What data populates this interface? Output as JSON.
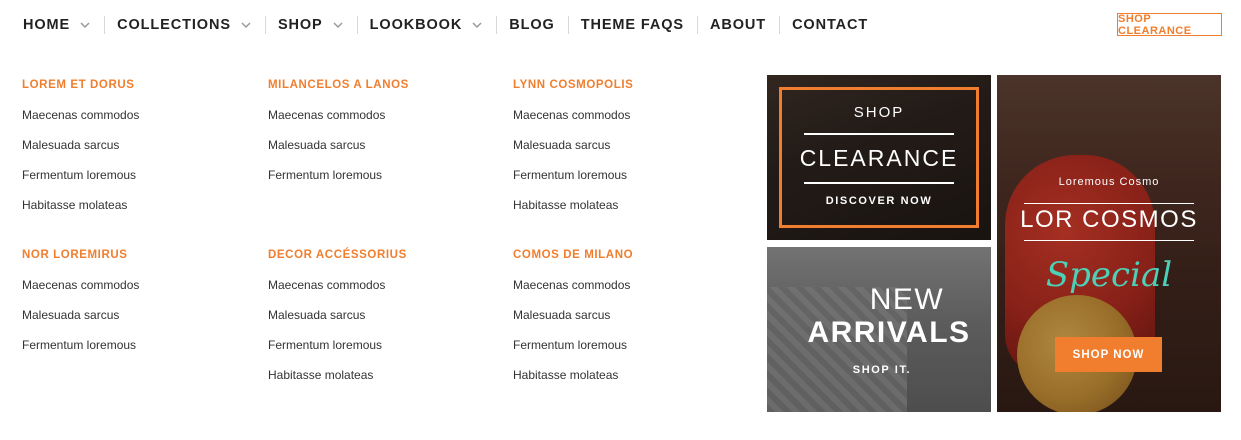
{
  "nav": {
    "items": [
      {
        "label": "HOME",
        "has_dropdown": true
      },
      {
        "label": "COLLECTIONS",
        "has_dropdown": true
      },
      {
        "label": "SHOP",
        "has_dropdown": true
      },
      {
        "label": "LOOKBOOK",
        "has_dropdown": true
      },
      {
        "label": "BLOG",
        "has_dropdown": false
      },
      {
        "label": "THEME FAQS",
        "has_dropdown": false
      },
      {
        "label": "ABOUT",
        "has_dropdown": false
      },
      {
        "label": "CONTACT",
        "has_dropdown": false
      }
    ],
    "clearance_button": "SHOP CLEARANCE",
    "dropdown_icon": "chevron-down-icon"
  },
  "menu": {
    "columns": [
      {
        "heading": "LOREM ET DORUS",
        "links": [
          "Maecenas commodos",
          "Malesuada sarcus",
          "Fermentum loremous",
          "Habitasse molateas"
        ]
      },
      {
        "heading": "MILANCELOS A LANOS",
        "links": [
          "Maecenas commodos",
          "Malesuada sarcus",
          "Fermentum loremous"
        ]
      },
      {
        "heading": "LYNN COSMOPOLIS",
        "links": [
          "Maecenas commodos",
          "Malesuada sarcus",
          "Fermentum loremous",
          "Habitasse molateas"
        ]
      },
      {
        "heading": "NOR LOREMIRUS",
        "links": [
          "Maecenas commodos",
          "Malesuada sarcus",
          "Fermentum loremous"
        ]
      },
      {
        "heading": "DECOR ACCÉSSORIUS",
        "links": [
          "Maecenas commodos",
          "Malesuada sarcus",
          "Fermentum loremous",
          "Habitasse molateas"
        ]
      },
      {
        "heading": "COMOS DE MILANO",
        "links": [
          "Maecenas commodos",
          "Malesuada sarcus",
          "Fermentum loremous",
          "Habitasse molateas"
        ]
      }
    ]
  },
  "promos": {
    "clearance": {
      "top": "SHOP",
      "title": "CLEARANCE",
      "cta": "DISCOVER NOW"
    },
    "new_arrivals": {
      "line1": "NEW",
      "line2": "ARRIVALS",
      "cta": "SHOP IT."
    },
    "cosmos": {
      "small": "Loremous Cosmo",
      "title": "LOR COSMOS",
      "script": "Special",
      "button": "SHOP NOW"
    }
  },
  "colors": {
    "accent": "#f07e2e",
    "script": "#4dd0b8",
    "text": "#222222"
  }
}
